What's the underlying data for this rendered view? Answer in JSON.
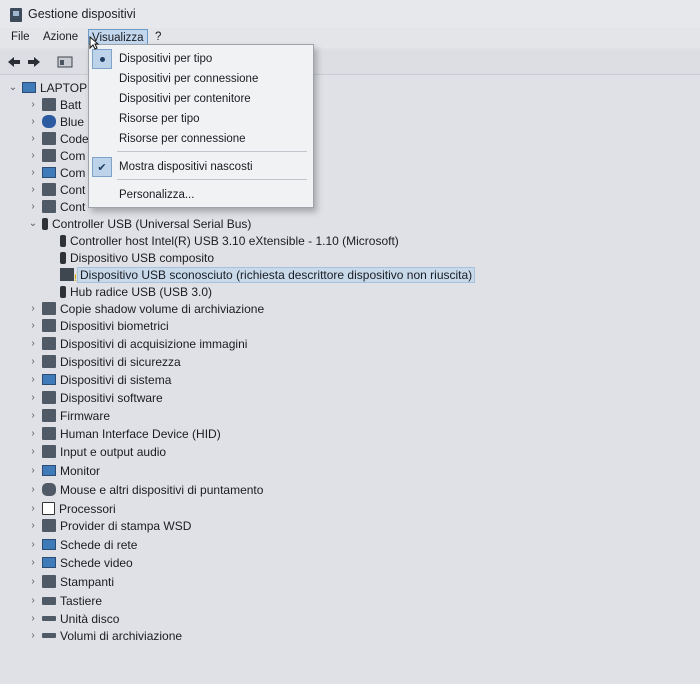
{
  "window": {
    "title": "Gestione dispositivi"
  },
  "menubar": [
    {
      "label": "File"
    },
    {
      "label": "Azione"
    },
    {
      "label": "Visualizza"
    },
    {
      "label": "?"
    }
  ],
  "view_menu": {
    "items": [
      {
        "label": "Dispositivi per tipo",
        "mark": "radio"
      },
      {
        "label": "Dispositivi per connessione",
        "mark": ""
      },
      {
        "label": "Dispositivi per contenitore",
        "mark": ""
      },
      {
        "label": "Risorse per tipo",
        "mark": ""
      },
      {
        "label": "Risorse per connessione",
        "mark": ""
      },
      {
        "label": "Mostra dispositivi nascosti",
        "mark": "check"
      },
      {
        "label": "Personalizza...",
        "mark": ""
      }
    ]
  },
  "tree": {
    "root": "LAPTOP",
    "partial_items": [
      "Batt",
      "Blue",
      "Code",
      "Com",
      "Com",
      "Cont",
      "Cont"
    ],
    "usb_controller": {
      "label": "Controller USB (Universal Serial Bus)",
      "children": [
        "Controller host Intel(R) USB 3.10 eXtensible - 1.10 (Microsoft)",
        "Dispositivo USB composito",
        "Dispositivo USB sconosciuto (richiesta descrittore dispositivo non riuscita)",
        "Hub radice USB (USB 3.0)"
      ],
      "selected_index": 2
    },
    "categories": [
      "Copie shadow volume di archiviazione",
      "Dispositivi biometrici",
      "Dispositivi di acquisizione immagini",
      "Dispositivi di sicurezza",
      "Dispositivi di sistema",
      "Dispositivi software",
      "Firmware",
      "Human Interface Device (HID)",
      "Input e output audio",
      "Monitor",
      "Mouse e altri dispositivi di puntamento",
      "Processori",
      "Provider di stampa WSD",
      "Schede di rete",
      "Schede video",
      "Stampanti",
      "Tastiere",
      "Unità disco",
      "Volumi di archiviazione"
    ]
  }
}
